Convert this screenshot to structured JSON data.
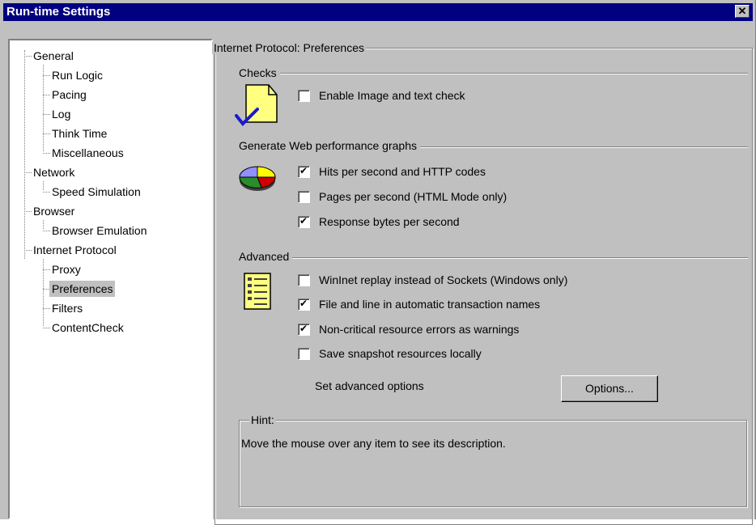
{
  "window": {
    "title": "Run-time Settings",
    "close_glyph": "✕"
  },
  "tree": {
    "items": [
      {
        "label": "General"
      },
      {
        "label": "Run Logic"
      },
      {
        "label": "Pacing"
      },
      {
        "label": "Log"
      },
      {
        "label": "Think Time"
      },
      {
        "label": "Miscellaneous"
      },
      {
        "label": "Network"
      },
      {
        "label": "Speed Simulation"
      },
      {
        "label": "Browser"
      },
      {
        "label": "Browser Emulation"
      },
      {
        "label": "Internet Protocol"
      },
      {
        "label": "Proxy"
      },
      {
        "label": "Preferences",
        "selected": true
      },
      {
        "label": "Filters"
      },
      {
        "label": "ContentCheck"
      }
    ]
  },
  "panel": {
    "title": "Internet Protocol: Preferences",
    "checks": {
      "label": "Checks",
      "icon": "document-check-icon",
      "items": [
        {
          "label": "Enable Image and text check",
          "checked": false
        }
      ]
    },
    "graphs": {
      "label": "Generate Web performance graphs",
      "icon": "pie-chart-icon",
      "items": [
        {
          "label": "Hits per second and HTTP codes",
          "checked": true
        },
        {
          "label": "Pages per second (HTML Mode only)",
          "checked": false
        },
        {
          "label": "Response bytes per second",
          "checked": true
        }
      ]
    },
    "advanced": {
      "label": "Advanced",
      "icon": "list-document-icon",
      "items": [
        {
          "label": "WinInet replay instead of Sockets (Windows only)",
          "checked": false
        },
        {
          "label": "File and line in automatic transaction names",
          "checked": true
        },
        {
          "label": "Non-critical resource errors as warnings",
          "checked": true
        },
        {
          "label": "Save snapshot resources locally",
          "checked": false
        }
      ],
      "options_text": "Set advanced options",
      "options_button": "Options..."
    },
    "hint": {
      "label": "Hint:",
      "text": "Move the mouse over any item to see its description."
    }
  },
  "colors": {
    "titlebar": "#000080",
    "face": "#c0c0c0",
    "selection": "#c0c0c0"
  }
}
